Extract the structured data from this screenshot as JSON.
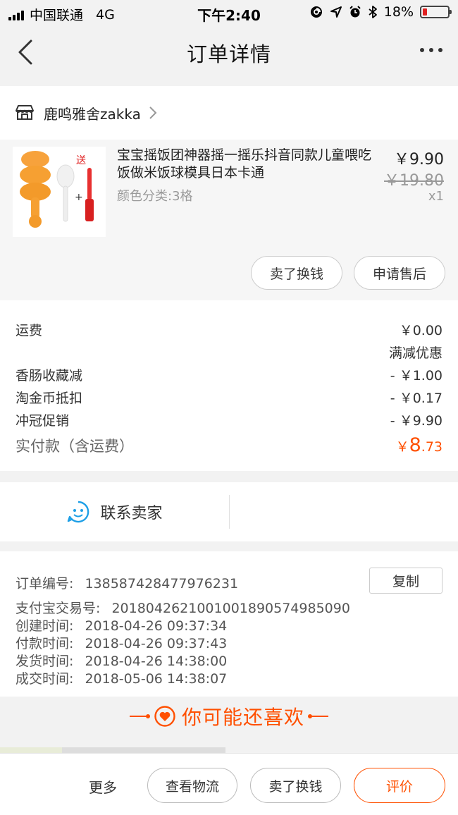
{
  "status_bar": {
    "carrier": "中国联通",
    "network": "4G",
    "time": "下午2:40",
    "battery": "18%",
    "battery_level": 0.18,
    "icons": [
      "signal-icon",
      "location-lock-icon",
      "location-arrow-icon",
      "alarm-icon",
      "bluetooth-icon",
      "battery-icon"
    ]
  },
  "nav": {
    "title": "订单详情",
    "back_icon": "chevron-left-icon",
    "more_icon": "more-dots-icon"
  },
  "shop": {
    "name": "鹿鸣雅舍zakka",
    "icon": "shop-icon"
  },
  "product": {
    "title": "宝宝摇饭团神器摇一摇乐抖音同款儿童喂吃饭做米饭球模具日本卡通",
    "spec": "颜色分类:3格",
    "price": "￥9.90",
    "original_price": "￥19.80",
    "quantity": "x1",
    "image_badge": "送",
    "image_plus": "+",
    "actions": [
      "卖了换钱",
      "申请售后"
    ]
  },
  "fees": {
    "shipping_label": "运费",
    "shipping_value": "￥0.00",
    "discount_header": "满减优惠",
    "items": [
      {
        "label": "香肠收藏减",
        "value": "- ￥1.00"
      },
      {
        "label": "淘金币抵扣",
        "value": "- ￥0.17"
      },
      {
        "label": "冲冠促销",
        "value": "- ￥9.90"
      }
    ],
    "total_label": "实付款（含运费）",
    "total_currency": "￥",
    "total_integer": "8",
    "total_decimal": ".73"
  },
  "contact": {
    "label": "联系卖家",
    "icon": "smiley-chat-icon"
  },
  "order_info": {
    "order_no_label": "订单编号:",
    "order_no": "138587428477976231",
    "copy_label": "复制",
    "lines": [
      {
        "label": "支付宝交易号:",
        "value": "2018042621001001890574985090"
      },
      {
        "label": "创建时间:",
        "value": "2018-04-26 09:37:34"
      },
      {
        "label": "付款时间:",
        "value": "2018-04-26 09:37:43"
      },
      {
        "label": "发货时间:",
        "value": "2018-04-26 14:38:00"
      },
      {
        "label": "成交时间:",
        "value": "2018-05-06 14:38:07"
      }
    ]
  },
  "recommend": {
    "title": "你可能还喜欢",
    "icon": "heart-circle-icon"
  },
  "bottom_bar": {
    "more_label": "更多",
    "buttons": [
      "查看物流",
      "卖了换钱",
      "评价"
    ]
  },
  "colors": {
    "accent": "#ff5000",
    "background": "#f2f2f2",
    "contact_icon": "#1e9fe6"
  }
}
